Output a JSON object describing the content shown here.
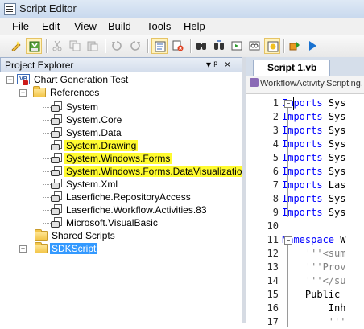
{
  "window": {
    "title": "Script Editor"
  },
  "menu": [
    "File",
    "Edit",
    "View",
    "Build",
    "Tools",
    "Help"
  ],
  "toolbar_icons": [
    "new-script-icon",
    "save-icon",
    "cut-icon",
    "copy-icon",
    "paste-icon",
    "undo-icon",
    "redo-icon",
    "project-explorer-icon",
    "references-icon",
    "find-icon",
    "find-replace-icon",
    "image-icon",
    "watch-icon",
    "breakpoint-icon",
    "build-icon",
    "run-icon"
  ],
  "project_explorer": {
    "title": "Project Explorer",
    "pin": "▾ ᵖ",
    "close": "×",
    "project": "Chart Generation Test",
    "references_folder": "References",
    "references": [
      {
        "label": "System",
        "highlight": false
      },
      {
        "label": "System.Core",
        "highlight": false
      },
      {
        "label": "System.Data",
        "highlight": false
      },
      {
        "label": "System.Drawing",
        "highlight": true
      },
      {
        "label": "System.Windows.Forms",
        "highlight": true
      },
      {
        "label": "System.Windows.Forms.DataVisualization",
        "highlight": true
      },
      {
        "label": "System.Xml",
        "highlight": false
      },
      {
        "label": "Laserfiche.RepositoryAccess",
        "highlight": false
      },
      {
        "label": "Laserfiche.Workflow.Activities.83",
        "highlight": false
      },
      {
        "label": "Microsoft.VisualBasic",
        "highlight": false
      }
    ],
    "shared_scripts": "Shared Scripts",
    "sdk_script": "SDKScript"
  },
  "editor": {
    "tab": "Script 1.vb",
    "class_selector": "WorkflowActivity.Scripting.",
    "lines": [
      {
        "n": "1",
        "kw": "Imports",
        "rest": " Sys"
      },
      {
        "n": "2",
        "kw": "Imports",
        "rest": " Sys"
      },
      {
        "n": "3",
        "kw": "Imports",
        "rest": " Sys"
      },
      {
        "n": "4",
        "kw": "Imports",
        "rest": " Sys"
      },
      {
        "n": "5",
        "kw": "Imports",
        "rest": " Sys"
      },
      {
        "n": "6",
        "kw": "Imports",
        "rest": " Sys"
      },
      {
        "n": "7",
        "kw": "Imports",
        "rest": " Las"
      },
      {
        "n": "8",
        "kw": "Imports",
        "rest": " Sys"
      },
      {
        "n": "9",
        "kw": "Imports",
        "rest": " Sys"
      },
      {
        "n": "10",
        "kw": "",
        "rest": ""
      },
      {
        "n": "11",
        "kw": "Namespace",
        "rest": " W"
      },
      {
        "n": "12",
        "kw": "",
        "rest": "    '''<sum"
      },
      {
        "n": "13",
        "kw": "",
        "rest": "    '''Prov"
      },
      {
        "n": "14",
        "kw": "",
        "rest": "    '''</su"
      },
      {
        "n": "15",
        "kw": "",
        "rest": "    Public "
      },
      {
        "n": "16",
        "kw": "",
        "rest": "        Inh"
      },
      {
        "n": "17",
        "kw": "",
        "rest": "        '''"
      }
    ]
  }
}
